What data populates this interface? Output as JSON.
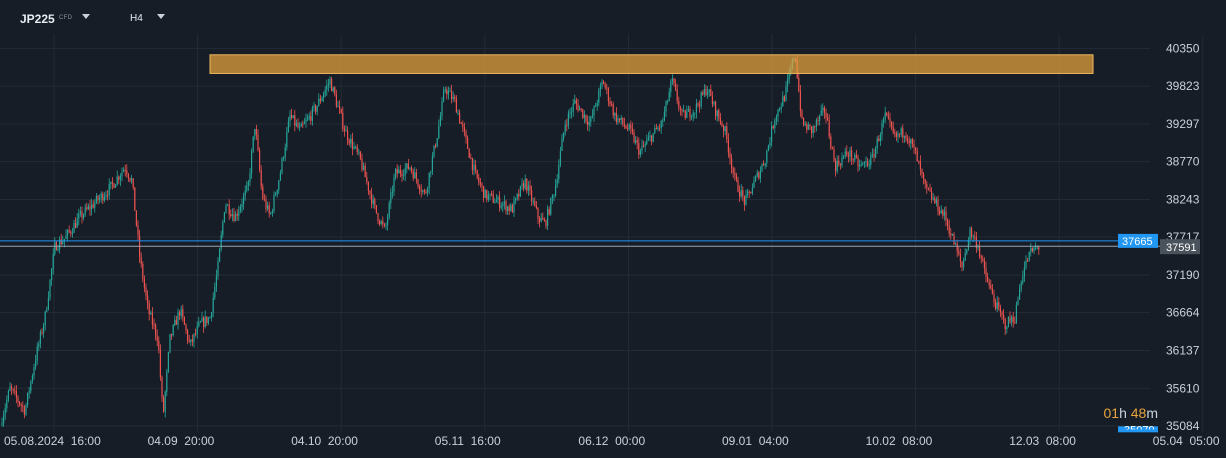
{
  "toolbar": {
    "symbol": "JP225",
    "symbol_tag": "CFD",
    "timeframe": "H4"
  },
  "countdown": {
    "hours": "01",
    "h_unit": "h",
    "minutes": "48",
    "m_unit": "m"
  },
  "colors": {
    "background": "#161d26",
    "grid": "#222b36",
    "bull": "#26a69a",
    "bear": "#ef5350",
    "resistance_zone": "#e8a33d",
    "current_price_line": "#2196f3",
    "last_price_line": "#9aa4ad"
  },
  "chart_data": {
    "type": "candlestick",
    "y_ticks": [
      "40350",
      "39823",
      "39297",
      "38770",
      "38243",
      "37717",
      "37190",
      "36664",
      "36137",
      "35610",
      "35084"
    ],
    "ylim": [
      35000,
      40550
    ],
    "x_ticks": [
      "05.08.2024  16:00",
      "04.09  20:00",
      "04.10  20:00",
      "05.11  16:00",
      "06.12  00:00",
      "09.01  04:00",
      "10.02  08:00",
      "12.03  08:00",
      "05.04  05:00"
    ],
    "resistance_zone": {
      "low": 40000,
      "high": 40260
    },
    "current_price": {
      "value": 37665,
      "label": "37665"
    },
    "last_price": {
      "value": 37591,
      "label": "37591"
    },
    "hidden_label": "35079",
    "price_path": [
      [
        0,
        35100
      ],
      [
        10,
        35600
      ],
      [
        25,
        35300
      ],
      [
        35,
        36000
      ],
      [
        45,
        36600
      ],
      [
        55,
        37600
      ],
      [
        65,
        37700
      ],
      [
        80,
        38000
      ],
      [
        95,
        38200
      ],
      [
        110,
        38400
      ],
      [
        125,
        38700
      ],
      [
        132,
        38500
      ],
      [
        140,
        37400
      ],
      [
        148,
        36700
      ],
      [
        158,
        36300
      ],
      [
        163,
        35200
      ],
      [
        170,
        36300
      ],
      [
        180,
        36700
      ],
      [
        190,
        36200
      ],
      [
        200,
        36500
      ],
      [
        210,
        36600
      ],
      [
        218,
        37300
      ],
      [
        225,
        38200
      ],
      [
        235,
        38000
      ],
      [
        248,
        38400
      ],
      [
        255,
        39300
      ],
      [
        262,
        38300
      ],
      [
        270,
        38000
      ],
      [
        280,
        38600
      ],
      [
        290,
        39400
      ],
      [
        300,
        39200
      ],
      [
        315,
        39500
      ],
      [
        330,
        39900
      ],
      [
        345,
        39200
      ],
      [
        360,
        38800
      ],
      [
        375,
        38100
      ],
      [
        385,
        37800
      ],
      [
        395,
        38600
      ],
      [
        410,
        38700
      ],
      [
        425,
        38300
      ],
      [
        438,
        39200
      ],
      [
        445,
        39800
      ],
      [
        455,
        39600
      ],
      [
        465,
        39100
      ],
      [
        475,
        38600
      ],
      [
        485,
        38300
      ],
      [
        500,
        38200
      ],
      [
        512,
        38100
      ],
      [
        525,
        38500
      ],
      [
        538,
        38000
      ],
      [
        545,
        37900
      ],
      [
        555,
        38400
      ],
      [
        565,
        39300
      ],
      [
        575,
        39600
      ],
      [
        590,
        39300
      ],
      [
        603,
        39900
      ],
      [
        615,
        39400
      ],
      [
        630,
        39200
      ],
      [
        640,
        38900
      ],
      [
        650,
        39100
      ],
      [
        662,
        39300
      ],
      [
        672,
        39900
      ],
      [
        682,
        39400
      ],
      [
        695,
        39500
      ],
      [
        707,
        39800
      ],
      [
        715,
        39500
      ],
      [
        725,
        39200
      ],
      [
        735,
        38500
      ],
      [
        745,
        38200
      ],
      [
        755,
        38500
      ],
      [
        765,
        38800
      ],
      [
        775,
        39400
      ],
      [
        785,
        39700
      ],
      [
        795,
        40300
      ],
      [
        802,
        39300
      ],
      [
        812,
        39200
      ],
      [
        825,
        39500
      ],
      [
        835,
        38700
      ],
      [
        848,
        38900
      ],
      [
        860,
        38700
      ],
      [
        872,
        38800
      ],
      [
        885,
        39400
      ],
      [
        895,
        39100
      ],
      [
        905,
        39200
      ],
      [
        915,
        38900
      ],
      [
        925,
        38400
      ],
      [
        935,
        38200
      ],
      [
        945,
        38000
      ],
      [
        955,
        37600
      ],
      [
        962,
        37300
      ],
      [
        970,
        37800
      ],
      [
        978,
        37600
      ],
      [
        985,
        37200
      ],
      [
        995,
        36800
      ],
      [
        1005,
        36500
      ],
      [
        1015,
        36600
      ],
      [
        1022,
        37200
      ],
      [
        1030,
        37500
      ],
      [
        1040,
        37591
      ]
    ]
  }
}
